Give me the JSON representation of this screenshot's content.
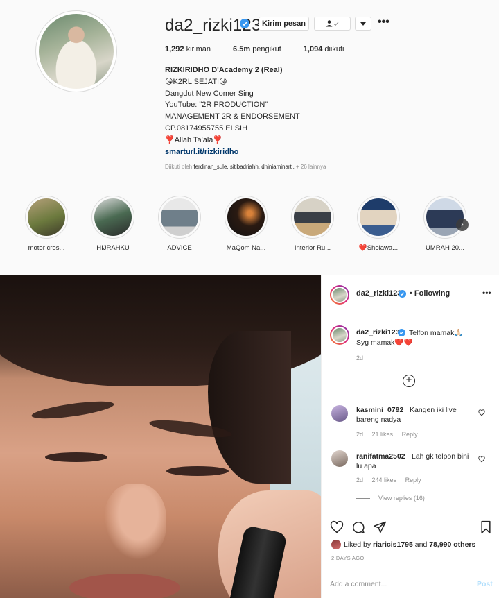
{
  "profile": {
    "username": "da2_rizki123",
    "message_button": "Kirim pesan",
    "more": "•••",
    "stats": {
      "posts_count": "1,292",
      "posts_label": "kiriman",
      "followers_count": "6.5m",
      "followers_label": "pengikut",
      "following_count": "1,094",
      "following_label": "diikuti"
    },
    "bio": {
      "name": "RIZKIRIDHO D'Academy 2 (Real)",
      "line1": "😘K2RL SEJATI😘",
      "line2": "Dangdut New Comer Sing",
      "line3": "YouTube: \"2R PRODUCTION\"",
      "line4": "MANAGEMENT 2R & ENDORSEMENT",
      "line5": "CP.08174955755 ELSIH",
      "line6": "❣️Allah Ta'ala❣️",
      "link": "smarturl.it/rizkiridho"
    },
    "followed_by": {
      "prefix": "Diikuti oleh",
      "users": "ferdinan_sule, sitibadriahh, dhiniaminarti,",
      "suffix": "+ 26 lainnya"
    }
  },
  "highlights": [
    {
      "label": "motor cros..."
    },
    {
      "label": "HIJRAHKU"
    },
    {
      "label": "ADVICE"
    },
    {
      "label": "MaQom Na..."
    },
    {
      "label": "Interior Ru..."
    },
    {
      "label": "❤️Sholawa..."
    },
    {
      "label": "UMRAH 20..."
    }
  ],
  "post": {
    "author": "da2_rizki123",
    "follow_state": "• Following",
    "more": "•••",
    "caption_line1": "Telfon mamak🙏🏻",
    "caption_line2": "Syg mamak❤️❤️",
    "caption_time": "2d",
    "load_more": "+",
    "comments": [
      {
        "user": "kasmini_0792",
        "text_line1": "Kangen iki live",
        "text_line2": "bareng nadya",
        "time": "2d",
        "likes": "21 likes",
        "reply": "Reply"
      },
      {
        "user": "ranifatma2502",
        "text_line1": "Lah gk telpon bini",
        "text_line2": "lu apa",
        "time": "2d",
        "likes": "244 likes",
        "reply": "Reply"
      }
    ],
    "view_replies": "View replies (16)",
    "liked_by_prefix": "Liked by",
    "liked_by_user": "riaricis1795",
    "liked_by_and": "and",
    "liked_by_others": "78,990 others",
    "time_ago": "2 DAYS AGO",
    "add_comment_placeholder": "Add a comment...",
    "post_button": "Post"
  },
  "colors": {
    "verified": "#3897f0",
    "link": "#00376b",
    "muted": "#8e8e8e",
    "post_button": "#b2dffc"
  }
}
